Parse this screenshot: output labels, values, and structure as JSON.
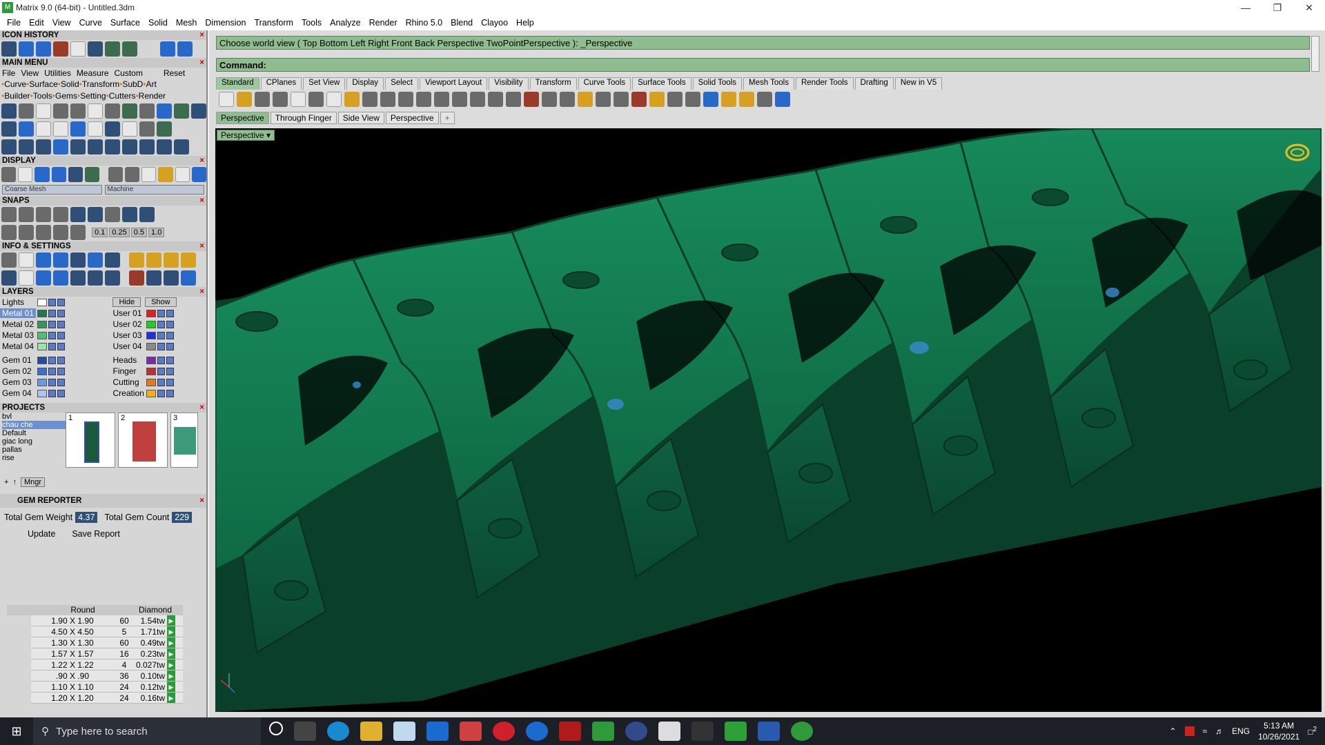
{
  "window": {
    "title": "Matrix 9.0 (64-bit) - Untitled.3dm",
    "app_icon": "rhino-icon"
  },
  "menubar": [
    "File",
    "Edit",
    "View",
    "Curve",
    "Surface",
    "Solid",
    "Mesh",
    "Dimension",
    "Transform",
    "Tools",
    "Analyze",
    "Render",
    "Rhino 5.0",
    "Blend",
    "Clayoo",
    "Help"
  ],
  "left": {
    "icon_history": "ICON HISTORY",
    "main_menu": "MAIN MENU",
    "main_menu_row1": [
      "File",
      "View",
      "Utilities",
      "Measure",
      "Custom"
    ],
    "reset": "Reset",
    "cats_row1": [
      "Curve",
      "Surface",
      "Solid",
      "Transform",
      "SubD",
      "Art"
    ],
    "cats_row2": [
      "Builder",
      "Tools",
      "Gems",
      "Setting",
      "Cutters",
      "Render"
    ],
    "display": "DISPLAY",
    "display_mesh": "Coarse Mesh",
    "display_material": "Machine",
    "snaps": "SNAPS",
    "snap_values": [
      "0.1",
      "0.25",
      "0.5",
      "1.0"
    ],
    "info": "INFO & SETTINGS",
    "layers_title": "LAYERS",
    "lights": "Lights",
    "hide": "Hide",
    "show": "Show",
    "layers_left": [
      {
        "name": "Metal 01",
        "color": "#1e7a4e",
        "sel": true
      },
      {
        "name": "Metal 02",
        "color": "#2e9a5a"
      },
      {
        "name": "Metal 03",
        "color": "#4cc06e"
      },
      {
        "name": "Metal 04",
        "color": "#9ee0a8"
      },
      {
        "name": "Gem 01",
        "color": "#1e4fa8"
      },
      {
        "name": "Gem 02",
        "color": "#3a70cf"
      },
      {
        "name": "Gem 03",
        "color": "#6a9ae0"
      },
      {
        "name": "Gem 04",
        "color": "#a8c6f0"
      }
    ],
    "layers_right": [
      {
        "name": "User 01",
        "color": "#e02020"
      },
      {
        "name": "User 02",
        "color": "#20d020"
      },
      {
        "name": "User 03",
        "color": "#2030e0"
      },
      {
        "name": "User 04",
        "color": "#8a8a8a"
      },
      {
        "name": "Heads",
        "color": "#7a2ab0"
      },
      {
        "name": "Finger",
        "color": "#c03030"
      },
      {
        "name": "Cutting",
        "color": "#e07a20"
      },
      {
        "name": "Creation",
        "color": "#f0b020"
      }
    ],
    "projects_title": "PROJECTS",
    "projects": [
      "bvl",
      "chau che",
      "Default",
      "giac long",
      "pallas",
      "rise"
    ],
    "project_thumbs": [
      "1",
      "2",
      "3"
    ],
    "mngr": "Mngr",
    "gem_reporter": "GEM REPORTER",
    "total_weight_label": "Total Gem Weight",
    "total_weight": "4.37",
    "total_count_label": "Total Gem Count",
    "total_count": "229",
    "update": "Update",
    "save_report": "Save Report",
    "gem_header": [
      "Round",
      "Diamond"
    ],
    "gems": [
      {
        "size": "1.90 X 1.90",
        "count": "60",
        "wt": "1.54tw"
      },
      {
        "size": "4.50 X 4.50",
        "count": "5",
        "wt": "1.71tw"
      },
      {
        "size": "1.30 X 1.30",
        "count": "60",
        "wt": "0.49tw"
      },
      {
        "size": "1.57 X 1.57",
        "count": "16",
        "wt": "0.23tw"
      },
      {
        "size": "1.22 X 1.22",
        "count": "4",
        "wt": "0.027tw"
      },
      {
        "size": ".90 X .90",
        "count": "36",
        "wt": "0.10tw"
      },
      {
        "size": "1.10 X 1.10",
        "count": "24",
        "wt": "0.12tw"
      },
      {
        "size": "1.20 X 1.20",
        "count": "24",
        "wt": "0.16tw"
      }
    ]
  },
  "command": {
    "history": "Choose world view ( Top  Bottom  Left  Right  Front  Back  Perspective  TwoPointPerspective ): _Perspective",
    "label": "Command:"
  },
  "toolbar_tabs": [
    "Standard",
    "CPlanes",
    "Set View",
    "Display",
    "Select",
    "Viewport Layout",
    "Visibility",
    "Transform",
    "Curve Tools",
    "Surface Tools",
    "Solid Tools",
    "Mesh Tools",
    "Render Tools",
    "Drafting",
    "New in V5"
  ],
  "viewport_tabs": [
    "Perspective",
    "Through Finger",
    "Side View",
    "Perspective"
  ],
  "viewport_label": "Perspective",
  "taskbar": {
    "search_placeholder": "Type here to search",
    "lang": "ENG",
    "time": "5:13 AM",
    "date": "10/26/2021",
    "notif": "2"
  }
}
